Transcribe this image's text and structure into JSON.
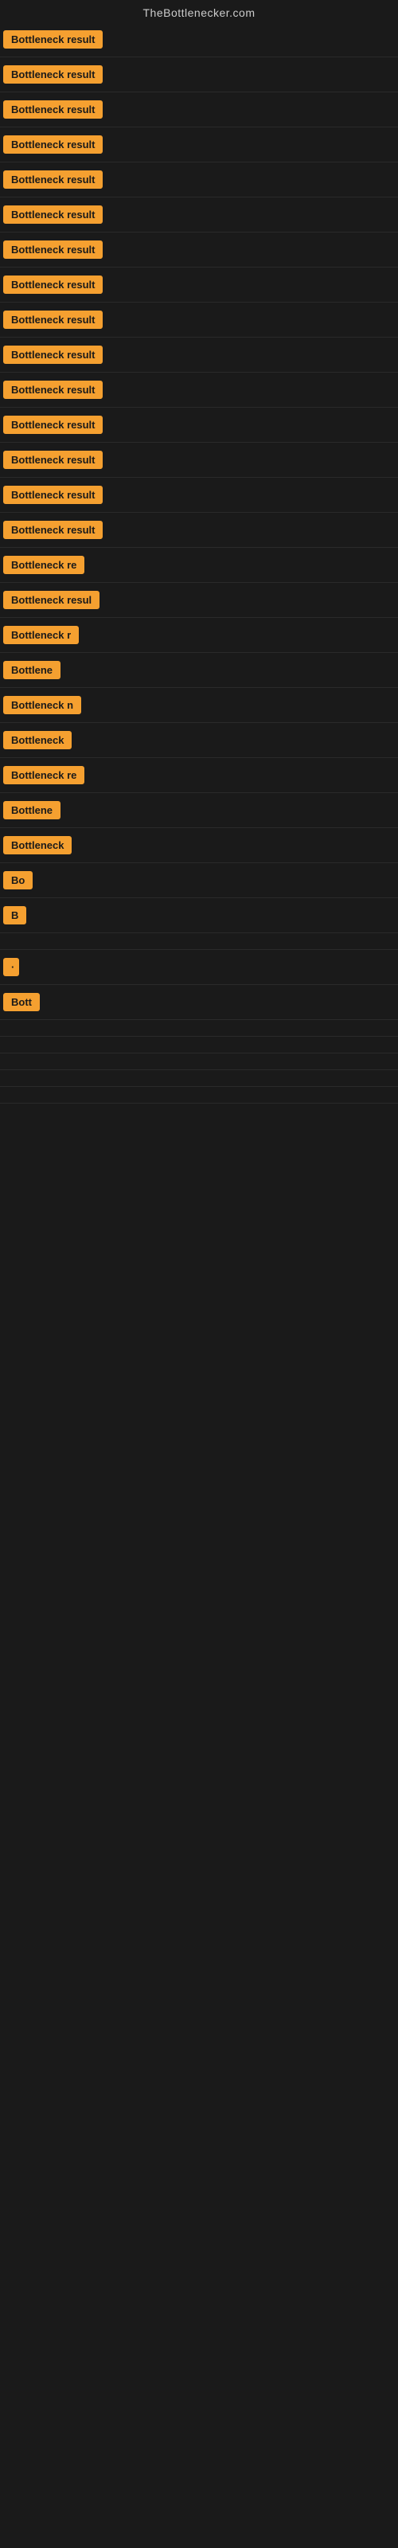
{
  "header": {
    "title": "TheBottlenecker.com"
  },
  "badge_label": "Bottleneck result",
  "rows": [
    {
      "id": 1,
      "clip": 140,
      "text": "Bottleneck result"
    },
    {
      "id": 2,
      "clip": 140,
      "text": "Bottleneck result"
    },
    {
      "id": 3,
      "clip": 140,
      "text": "Bottleneck result"
    },
    {
      "id": 4,
      "clip": 140,
      "text": "Bottleneck result"
    },
    {
      "id": 5,
      "clip": 140,
      "text": "Bottleneck result"
    },
    {
      "id": 6,
      "clip": 140,
      "text": "Bottleneck result"
    },
    {
      "id": 7,
      "clip": 140,
      "text": "Bottleneck result"
    },
    {
      "id": 8,
      "clip": 140,
      "text": "Bottleneck result"
    },
    {
      "id": 9,
      "clip": 140,
      "text": "Bottleneck result"
    },
    {
      "id": 10,
      "clip": 140,
      "text": "Bottleneck result"
    },
    {
      "id": 11,
      "clip": 140,
      "text": "Bottleneck result"
    },
    {
      "id": 12,
      "clip": 140,
      "text": "Bottleneck result"
    },
    {
      "id": 13,
      "clip": 140,
      "text": "Bottleneck result"
    },
    {
      "id": 14,
      "clip": 140,
      "text": "Bottleneck result"
    },
    {
      "id": 15,
      "clip": 140,
      "text": "Bottleneck result"
    },
    {
      "id": 16,
      "clip": 115,
      "text": "Bottleneck re"
    },
    {
      "id": 17,
      "clip": 130,
      "text": "Bottleneck resul"
    },
    {
      "id": 18,
      "clip": 100,
      "text": "Bottleneck r"
    },
    {
      "id": 19,
      "clip": 80,
      "text": "Bottlene"
    },
    {
      "id": 20,
      "clip": 110,
      "text": "Bottleneck n"
    },
    {
      "id": 21,
      "clip": 95,
      "text": "Bottleneck"
    },
    {
      "id": 22,
      "clip": 110,
      "text": "Bottleneck re"
    },
    {
      "id": 23,
      "clip": 78,
      "text": "Bottlene"
    },
    {
      "id": 24,
      "clip": 90,
      "text": "Bottleneck"
    },
    {
      "id": 25,
      "clip": 50,
      "text": "Bo"
    },
    {
      "id": 26,
      "clip": 30,
      "text": "B"
    },
    {
      "id": 27,
      "clip": 10,
      "text": ""
    },
    {
      "id": 28,
      "clip": 12,
      "text": "·"
    },
    {
      "id": 29,
      "clip": 50,
      "text": "Bott"
    },
    {
      "id": 30,
      "clip": 0,
      "text": ""
    },
    {
      "id": 31,
      "clip": 0,
      "text": ""
    },
    {
      "id": 32,
      "clip": 0,
      "text": ""
    },
    {
      "id": 33,
      "clip": 0,
      "text": ""
    },
    {
      "id": 34,
      "clip": 0,
      "text": ""
    }
  ]
}
